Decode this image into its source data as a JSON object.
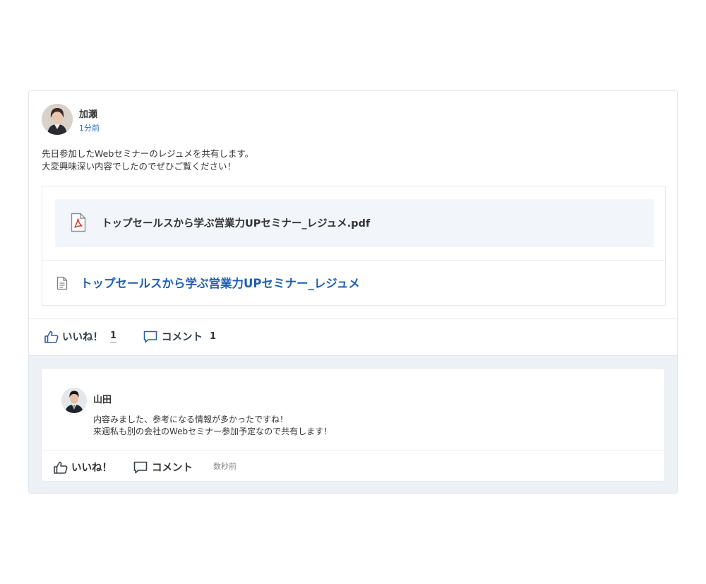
{
  "post": {
    "author": "加瀬",
    "time": "1分前",
    "body_lines": [
      "先日参加したWebセミナーのレジュメを共有します。",
      "大変興味深い内容でしたのでぜひご覧ください！"
    ],
    "attachment": {
      "file_name": "トップセールスから学ぶ営業力UPセミナー_レジュメ.pdf",
      "doc_link": "トップセールスから学ぶ営業力UPセミナー_レジュメ"
    },
    "actions": {
      "like_label": "いいね！",
      "like_count": "1",
      "comment_label": "コメント",
      "comment_count": "1"
    }
  },
  "comment": {
    "author": "山田",
    "text_lines": [
      "内容みました、参考になる情報が多かったですね！",
      "来週私も別の会社のWebセミナー参加予定なので共有します！"
    ],
    "like_label": "いいね！",
    "comment_label": "コメント",
    "time": "数秒前"
  },
  "icons": {
    "like": "thumbs-up-icon",
    "comment": "speech-bubble-icon",
    "pdf": "pdf-file-icon",
    "doc": "document-icon"
  },
  "colors": {
    "link": "#1f5fb4",
    "time": "#2a6fbf",
    "file_row_bg": "#f2f6fb",
    "comments_bg": "#edf1f6",
    "pdf_red": "#d0312d"
  }
}
